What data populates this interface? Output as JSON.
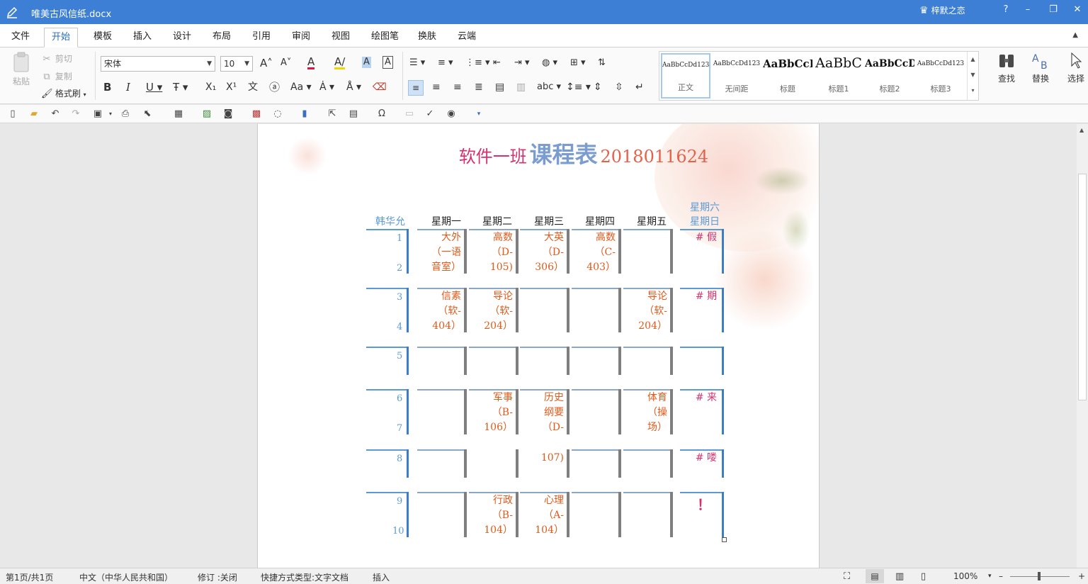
{
  "window": {
    "title": "唯美古风信纸.docx",
    "user": "梓默之恋",
    "help": "?",
    "minimize": "–",
    "restore": "❐",
    "close": "✕"
  },
  "tabs": [
    "文件",
    "开始",
    "模板",
    "插入",
    "设计",
    "布局",
    "引用",
    "审阅",
    "视图",
    "绘图笔",
    "换肤",
    "云端"
  ],
  "active_tab": "开始",
  "ribbon": {
    "paste": "粘贴",
    "cut": "剪切",
    "copy": "复制",
    "format_painter": "格式刷",
    "font_name": "宋体",
    "font_size": "10",
    "find": "查找",
    "replace": "替换",
    "select": "选择",
    "styles": [
      {
        "preview": "AaBbCcDd123",
        "name": "正文"
      },
      {
        "preview": "AaBbCcDd123",
        "name": "无间距"
      },
      {
        "preview": "AaBbCcD",
        "name": "标题"
      },
      {
        "preview": "AaBbC",
        "name": "标题1"
      },
      {
        "preview": "AaBbCcD",
        "name": "标题2"
      },
      {
        "preview": "AaBbCcDd123",
        "name": "标题3"
      }
    ]
  },
  "document": {
    "title_part1": "软件一班",
    "title_part2": "课程表",
    "title_part3": "2018011624",
    "table": {
      "corner": "韩华允",
      "days": [
        "星期一",
        "星期二",
        "星期三",
        "星期四",
        "星期五"
      ],
      "weekend_1": "星期六",
      "weekend_2": "星期日",
      "periods": [
        "1",
        "2",
        "3",
        "4",
        "5",
        "6",
        "7",
        "8",
        "9",
        "10"
      ],
      "cells": {
        "r1_mon": [
          "大外",
          "（一语",
          "音室）"
        ],
        "r1_tue": [
          "高数",
          "（D-",
          "105)"
        ],
        "r1_wed": [
          "大英",
          "（D-",
          "306）"
        ],
        "r1_thu": [
          "高数",
          "（C-",
          "403）"
        ],
        "r2_mon": [
          "信素",
          "（软-",
          "404）"
        ],
        "r2_tue": [
          "导论",
          "（软-",
          "204）"
        ],
        "r2_fri": [
          "导论",
          "（软-",
          "204）"
        ],
        "r4_tue": [
          "军事",
          "（B-",
          "106）"
        ],
        "r4_wed": [
          "历史",
          "纲要",
          "（D-"
        ],
        "r4_fri": [
          "体育",
          "（操",
          "场）"
        ],
        "r5_wed": [
          "107)"
        ],
        "r6_tue": [
          "行政",
          "（B-",
          "104）"
        ],
        "r6_wed": [
          "心理",
          "（A-",
          "104）"
        ]
      },
      "weekend": [
        "# 假",
        "# 期",
        "# 来",
        "# 喽",
        "！"
      ]
    }
  },
  "status": {
    "page": "第1页/共1页",
    "language": "中文（中华人民共和国）",
    "revision": "修订 :关闭",
    "doc_type": "快捷方式类型:文字文档",
    "insert_mode": "插入",
    "zoom": "100%"
  }
}
